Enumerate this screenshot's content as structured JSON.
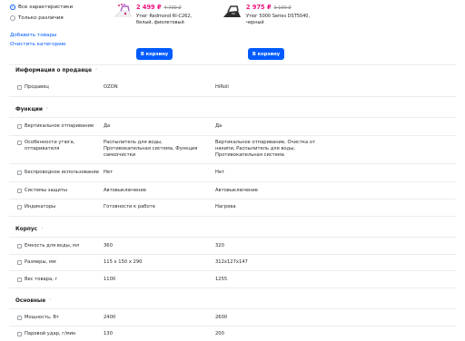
{
  "filters": {
    "all_label": "Все характеристики",
    "diff_label": "Только различия",
    "add_products": "Добавить товары",
    "clear_category": "Очистить категорию"
  },
  "products": [
    {
      "price": "2 499 ₽",
      "old_price": "4 799 ₽",
      "name_line1": "Утюг Redmond RI-C262,",
      "name_line2": "белый, фиолетовый",
      "cart_label": "В корзину",
      "icon": "iron-white-purple-thumbnail"
    },
    {
      "price": "2 975 ₽",
      "old_price": "3 190 ₽",
      "name_line1": "Утюг 5000 Series DST5040,",
      "name_line2": "черный",
      "cart_label": "В корзину",
      "icon": "iron-black-thumbnail"
    }
  ],
  "sections": [
    {
      "title": "Информация о продавце",
      "rows": [
        {
          "label": "Продавец",
          "v1": "OZON",
          "v2": "HiRoll"
        }
      ]
    },
    {
      "title": "Функции",
      "rows": [
        {
          "label": "Вертикальное отпаривание",
          "v1": "Да",
          "v2": "Да"
        },
        {
          "label": "Особенности утюга, отпаривателя",
          "v1": "Распылитель для воды, Противокапельная система, Функция самоочистки",
          "v2": "Вертикальное отпаривание, Очистка от накипи, Распылитель для воды, Противокапельная система"
        },
        {
          "label": "Беспроводное использование",
          "v1": "Нет",
          "v2": "Нет"
        },
        {
          "label": "Системы защиты",
          "v1": "Автовыключение",
          "v2": "Автовыключение"
        },
        {
          "label": "Индикаторы",
          "v1": "Готовности к работе",
          "v2": "Нагрева"
        }
      ]
    },
    {
      "title": "Корпус",
      "rows": [
        {
          "label": "Емкость для воды, мл",
          "v1": "360",
          "v2": "320"
        },
        {
          "label": "Размеры, мм",
          "v1": "115 x 150 x 290",
          "v2": "312x127x147"
        },
        {
          "label": "Вес товара, г",
          "v1": "1100",
          "v2": "1255"
        }
      ]
    },
    {
      "title": "Основные",
      "rows": [
        {
          "label": "Мощность, Вт",
          "v1": "2400",
          "v2": "2600"
        },
        {
          "label": "Паровой удар, г/мин",
          "v1": "130",
          "v2": "200"
        }
      ]
    }
  ],
  "colors": {
    "accent": "#005bff",
    "price": "#f1117e"
  }
}
